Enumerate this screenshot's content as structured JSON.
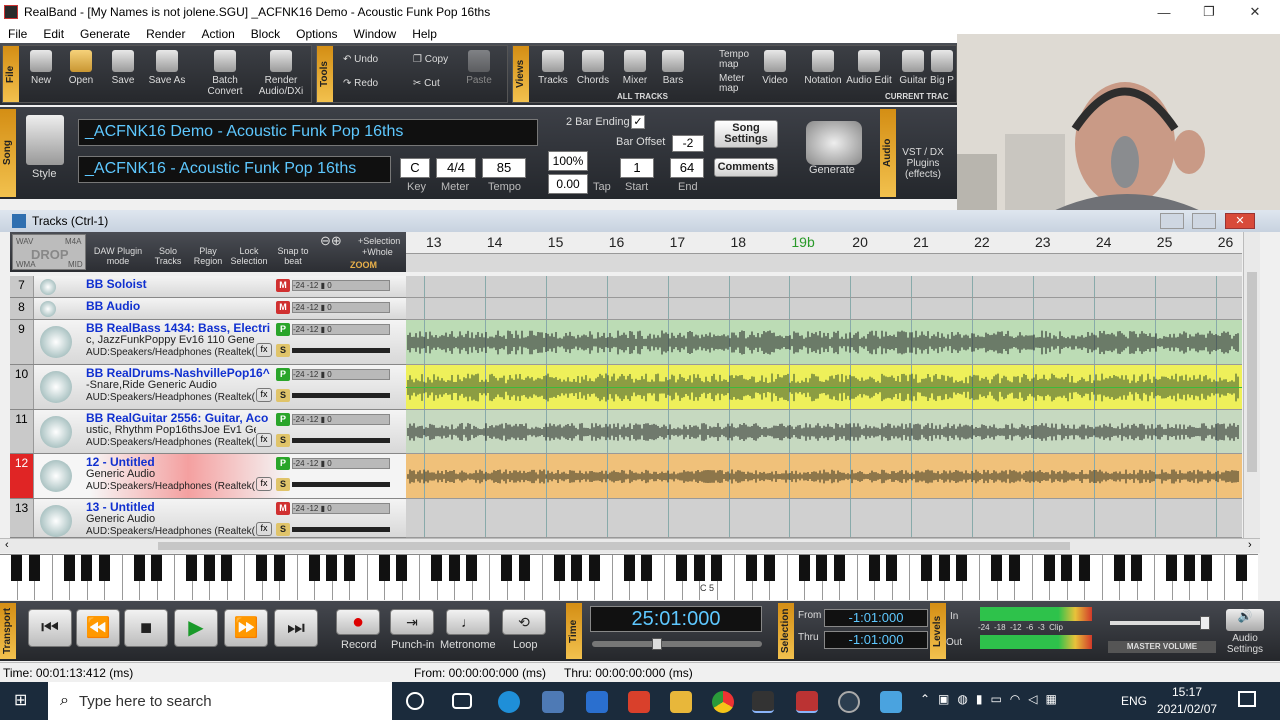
{
  "window": {
    "title": "RealBand - [My Names is not jolene.SGU]   _ACFNK16 Demo - Acoustic Funk Pop 16ths",
    "minimize": "—",
    "maximize": "❐",
    "close": "✕"
  },
  "menu": [
    "File",
    "Edit",
    "Generate",
    "Render",
    "Action",
    "Block",
    "Options",
    "Window",
    "Help"
  ],
  "toolbar": {
    "file_label": "File",
    "new": "New",
    "open": "Open",
    "save": "Save",
    "save_as": "Save As",
    "batch_convert": "Batch Convert",
    "render_audio": "Render Audio/DXi",
    "tools_label": "Tools",
    "undo": "Undo",
    "redo": "Redo",
    "copy": "Copy",
    "cut": "Cut",
    "paste": "Paste",
    "views_label": "Views",
    "tracks": "Tracks",
    "chords": "Chords",
    "mixer": "Mixer",
    "bars": "Bars",
    "tempo_map": "Tempo map",
    "meter_map": "Meter map",
    "video": "Video",
    "notation": "Notation",
    "audio_edit": "Audio Edit",
    "guitar": "Guitar",
    "big_piano": "Big P",
    "all_tracks": "ALL TRACKS",
    "current_track": "CURRENT TRAC"
  },
  "song": {
    "section_label": "Song",
    "style_label": "Style",
    "title": "_ACFNK16 Demo - Acoustic Funk Pop 16ths",
    "style_name": "_ACFNK16 - Acoustic Funk Pop 16ths",
    "key": "C",
    "key_label": "Key",
    "meter": "4/4",
    "meter_label": "Meter",
    "tempo": "85",
    "tempo_label": "Tempo",
    "tempo_pct": "100%",
    "tempo_offset": "0.00",
    "tap_label": "Tap",
    "two_bar_ending": "2 Bar Ending",
    "bar_offset_label": "Bar Offset",
    "bar_offset": "-2",
    "start": "1",
    "start_label": "Start",
    "end": "64",
    "end_label": "End",
    "song_settings": "Song Settings",
    "comments": "Comments",
    "generate": "Generate",
    "audio_label": "Audio",
    "vst_plugins": "VST / DX Plugins (effects)"
  },
  "tracks_window": {
    "title": "Tracks (Ctrl-1)",
    "drop_zone": [
      "WAV",
      "M4A",
      "DROP",
      "WMA",
      "MID"
    ],
    "daw_plugin": "DAW Plugin mode",
    "solo_tracks": "Solo Tracks",
    "play_region": "Play Region",
    "lock_selection": "Lock Selection",
    "snap_to_beat": "Snap to beat",
    "selection": "+Selection",
    "whole": "+Whole",
    "zoom": "ZOOM",
    "bars": [
      "13",
      "14",
      "15",
      "16",
      "17",
      "18",
      "19b",
      "20",
      "21",
      "22",
      "23",
      "24",
      "25",
      "26"
    ]
  },
  "tracks": [
    {
      "num": "7",
      "name": "BB Soloist",
      "sub1": "",
      "sub2": "",
      "btn": "M"
    },
    {
      "num": "8",
      "name": "BB Audio",
      "sub1": "",
      "sub2": "",
      "btn": "M"
    },
    {
      "num": "9",
      "name": "BB RealBass 1434: Bass, Electri",
      "sub1": "c, JazzFunkPoppy Ev16 110 Gene",
      "sub2": "AUD:Speakers/Headphones (Realtek(",
      "btn": "P"
    },
    {
      "num": "10",
      "name": "BB RealDrums-NashvillePop16^",
      "sub1": "-Snare,Ride Generic Audio",
      "sub2": "AUD:Speakers/Headphones (Realtek(",
      "btn": "P"
    },
    {
      "num": "11",
      "name": "BB RealGuitar 2556: Guitar, Aco",
      "sub1": "ustic, Rhythm Pop16thsJoe Ev1 Ge",
      "sub2": "AUD:Speakers/Headphones (Realtek(",
      "btn": "P"
    },
    {
      "num": "12",
      "name": "12 - Untitled",
      "sub1": "Generic Audio",
      "sub2": "AUD:Speakers/Headphones (Realtek(",
      "btn": "P"
    },
    {
      "num": "13",
      "name": "13 - Untitled",
      "sub1": "Generic Audio",
      "sub2": "AUD:Speakers/Headphones (Realtek(",
      "btn": "M"
    }
  ],
  "track_meter_scale": "-24  -12  ▮  0",
  "piano_label": "C 5",
  "transport": {
    "label": "Transport",
    "record": "Record",
    "punch_in": "Punch-in",
    "metronome": "Metronome",
    "loop": "Loop",
    "time_label": "Time",
    "time": "25:01:000",
    "selection_label": "Selection",
    "from_label": "From",
    "from": "-1:01:000",
    "thru_label": "Thru",
    "thru": "-1:01:000",
    "levels_label": "Levels",
    "in": "In",
    "out": "Out",
    "level_scale": "-24  -18  -12  -6  -3  Clip",
    "master_volume": "MASTER VOLUME",
    "audio_settings": "Audio Settings"
  },
  "status": {
    "time": "Time: 00:01:13:412 (ms)",
    "from": "From: 00:00:00:000 (ms)",
    "thru": "Thru: 00:00:00:000 (ms)"
  },
  "taskbar": {
    "search_placeholder": "Type here to search",
    "lang": "ENG",
    "clock": "15:17",
    "date": "2021/02/07"
  },
  "colors": {
    "lcd_text": "#5ec8ff",
    "accent_orange": "#e0a030",
    "selected_track": "#e02525"
  }
}
